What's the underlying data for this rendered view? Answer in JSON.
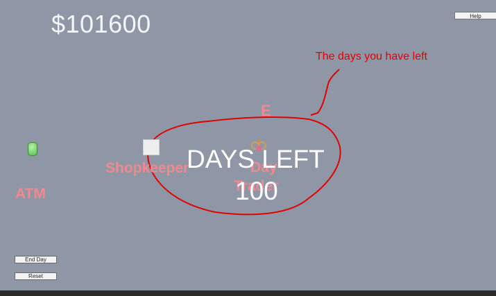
{
  "hud": {
    "money": "$101600",
    "help_label": "Help"
  },
  "controls": {
    "end_day_label": "End Day",
    "reset_label": "Reset"
  },
  "world": {
    "atm_label": "ATM",
    "shopkeeper_label": "Shopkeeper",
    "day_trader_line1": "Day",
    "day_trader_line2": "Trader",
    "interact_key": "E"
  },
  "days": {
    "title": "DAYS LEFT",
    "value": "100"
  },
  "annotation": {
    "text": "The days you have left",
    "color": "#e00000"
  },
  "icons": {
    "atm": "green-capsule-icon",
    "shopkeeper": "white-square-icon",
    "day_trader": "trader-character-icon"
  }
}
